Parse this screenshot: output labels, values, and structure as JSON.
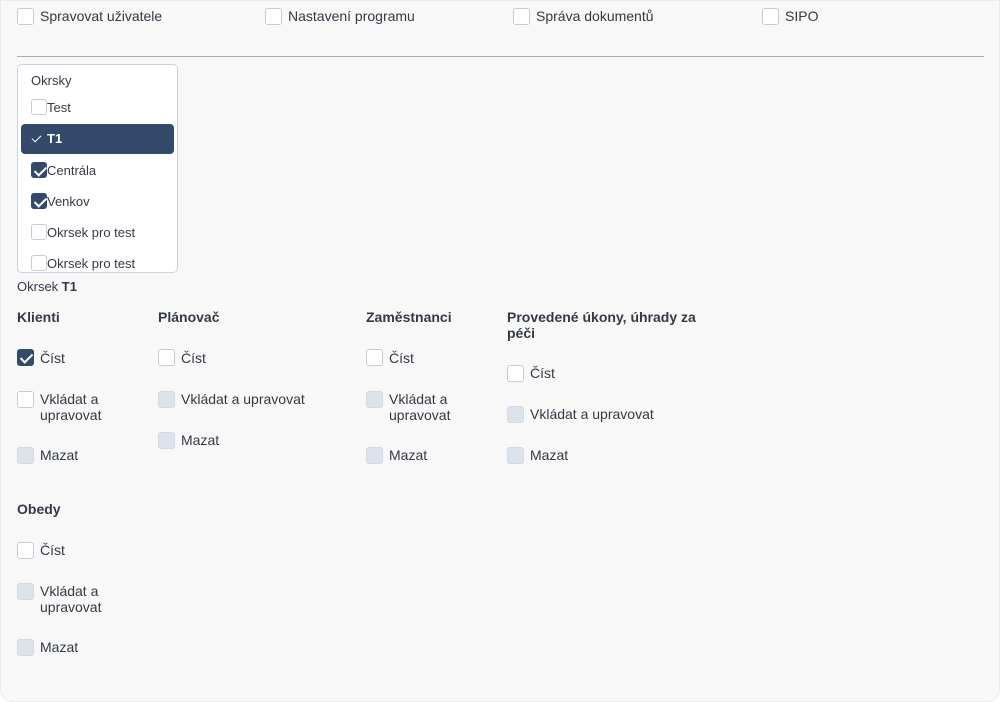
{
  "top_permissions": [
    {
      "label": "Spravovat uživatele",
      "checked": false
    },
    {
      "label": "Nastavení programu",
      "checked": false
    },
    {
      "label": "Správa dokumentů",
      "checked": false
    },
    {
      "label": "SIPO",
      "checked": false
    }
  ],
  "districts": {
    "title": "Okrsky",
    "items": [
      {
        "label": "Test",
        "checked": false,
        "active": false
      },
      {
        "label": "T1",
        "checked": true,
        "active": true
      },
      {
        "label": "Centrála",
        "checked": true,
        "active": false
      },
      {
        "label": "Venkov",
        "checked": true,
        "active": false
      },
      {
        "label": "Okrsek pro test",
        "checked": false,
        "active": false
      },
      {
        "label": "Okrsek pro test",
        "checked": false,
        "active": false
      }
    ]
  },
  "selected_district": {
    "prefix": "Okrsek",
    "name": "T1"
  },
  "sections": [
    {
      "title": "Klienti",
      "options": [
        {
          "label": "Číst",
          "checked": true,
          "enabled": true
        },
        {
          "label": "Vkládat a upravovat",
          "checked": false,
          "enabled": true
        },
        {
          "label": "Mazat",
          "checked": false,
          "enabled": false
        }
      ]
    },
    {
      "title": "Plánovač",
      "options": [
        {
          "label": "Číst",
          "checked": false,
          "enabled": true
        },
        {
          "label": "Vkládat a upravovat",
          "checked": false,
          "enabled": false
        },
        {
          "label": "Mazat",
          "checked": false,
          "enabled": false
        }
      ]
    },
    {
      "title": "Zaměstnanci",
      "options": [
        {
          "label": "Číst",
          "checked": false,
          "enabled": true
        },
        {
          "label": "Vkládat a upravovat",
          "checked": false,
          "enabled": false
        },
        {
          "label": "Mazat",
          "checked": false,
          "enabled": false
        }
      ]
    },
    {
      "title": "Provedené úkony, úhrady za péči",
      "options": [
        {
          "label": "Číst",
          "checked": false,
          "enabled": true
        },
        {
          "label": "Vkládat a upravovat",
          "checked": false,
          "enabled": false
        },
        {
          "label": "Mazat",
          "checked": false,
          "enabled": false
        }
      ]
    },
    {
      "title": "Obedy",
      "options": [
        {
          "label": "Číst",
          "checked": false,
          "enabled": true
        },
        {
          "label": "Vkládat a upravovat",
          "checked": false,
          "enabled": false
        },
        {
          "label": "Mazat",
          "checked": false,
          "enabled": false
        }
      ]
    }
  ],
  "colors": {
    "accent": "#344a6b",
    "disabled_checkbox": "#dde3ea",
    "panel_bg": "#f8f8f8"
  }
}
